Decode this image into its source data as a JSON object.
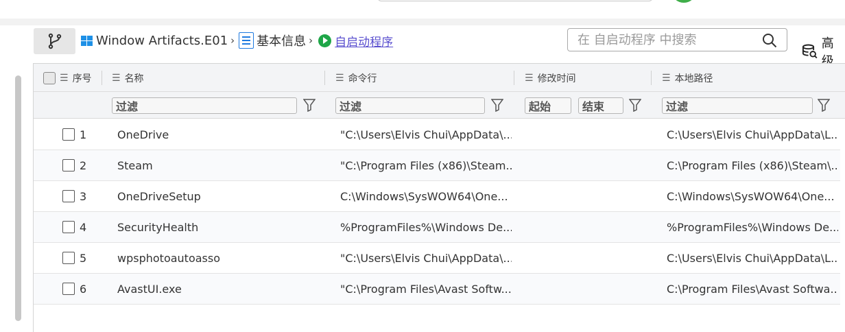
{
  "toolbar": {
    "breadcrumb": {
      "source": "Window Artifacts.E01",
      "section": "基本信息",
      "current": "自启动程序",
      "sep": "›"
    },
    "search": {
      "placeholder": "在 自启动程序 中搜索"
    },
    "advanced_label": "高级"
  },
  "table": {
    "columns": {
      "index": "序号",
      "name": "名称",
      "cmd": "命令行",
      "mtime": "修改时间",
      "path": "本地路径"
    },
    "filters": {
      "name": "过滤",
      "cmd": "过滤",
      "mtime_start": "起始",
      "mtime_end": "结束",
      "path": "过滤"
    },
    "rows": [
      {
        "index": "1",
        "name": "OneDrive",
        "cmd": "\"C:\\Users\\Elvis Chui\\AppData\\...",
        "mtime": "",
        "path": "C:\\Users\\Elvis Chui\\AppData\\L..."
      },
      {
        "index": "2",
        "name": "Steam",
        "cmd": "\"C:\\Program Files (x86)\\Steam...",
        "mtime": "",
        "path": "C:\\Program Files (x86)\\Steam\\..."
      },
      {
        "index": "3",
        "name": "OneDriveSetup",
        "cmd": "C:\\Windows\\SysWOW64\\One...",
        "mtime": "",
        "path": "C:\\Windows\\SysWOW64\\One..."
      },
      {
        "index": "4",
        "name": "SecurityHealth",
        "cmd": "%ProgramFiles%\\Windows De...",
        "mtime": "",
        "path": "%ProgramFiles%\\Windows De..."
      },
      {
        "index": "5",
        "name": "wpsphotoautoasso",
        "cmd": "\"C:\\Users\\Elvis Chui\\AppData\\...",
        "mtime": "",
        "path": "C:\\Users\\Elvis Chui\\AppData\\L..."
      },
      {
        "index": "6",
        "name": "AvastUI.exe",
        "cmd": "\"C:\\Program Files\\Avast Softw...",
        "mtime": "",
        "path": "C:\\Program Files\\Avast Softwa..."
      }
    ]
  },
  "colors": {
    "accent_link": "#5a4fcf",
    "play_green": "#1fa648",
    "win_blue": "#1e90e6"
  }
}
